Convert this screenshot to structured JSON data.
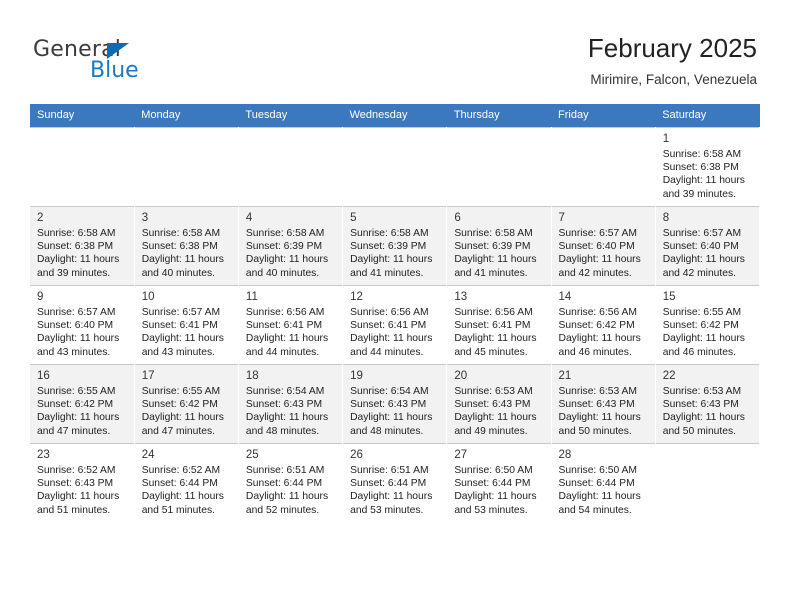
{
  "brand": {
    "name_top": "General",
    "name_bottom": "Blue"
  },
  "header": {
    "title": "February 2025",
    "subtitle": "Mirimire, Falcon, Venezuela"
  },
  "colors": {
    "header_blue": "#3b78bf",
    "brand_blue": "#1a7bc4",
    "row_shade": "#f2f2f2"
  },
  "weekdays": [
    "Sunday",
    "Monday",
    "Tuesday",
    "Wednesday",
    "Thursday",
    "Friday",
    "Saturday"
  ],
  "weeks": [
    [
      {
        "day": ""
      },
      {
        "day": ""
      },
      {
        "day": ""
      },
      {
        "day": ""
      },
      {
        "day": ""
      },
      {
        "day": ""
      },
      {
        "day": "1",
        "sunrise": "Sunrise: 6:58 AM",
        "sunset": "Sunset: 6:38 PM",
        "daylight": "Daylight: 11 hours and 39 minutes."
      }
    ],
    [
      {
        "day": "2",
        "sunrise": "Sunrise: 6:58 AM",
        "sunset": "Sunset: 6:38 PM",
        "daylight": "Daylight: 11 hours and 39 minutes."
      },
      {
        "day": "3",
        "sunrise": "Sunrise: 6:58 AM",
        "sunset": "Sunset: 6:38 PM",
        "daylight": "Daylight: 11 hours and 40 minutes."
      },
      {
        "day": "4",
        "sunrise": "Sunrise: 6:58 AM",
        "sunset": "Sunset: 6:39 PM",
        "daylight": "Daylight: 11 hours and 40 minutes."
      },
      {
        "day": "5",
        "sunrise": "Sunrise: 6:58 AM",
        "sunset": "Sunset: 6:39 PM",
        "daylight": "Daylight: 11 hours and 41 minutes."
      },
      {
        "day": "6",
        "sunrise": "Sunrise: 6:58 AM",
        "sunset": "Sunset: 6:39 PM",
        "daylight": "Daylight: 11 hours and 41 minutes."
      },
      {
        "day": "7",
        "sunrise": "Sunrise: 6:57 AM",
        "sunset": "Sunset: 6:40 PM",
        "daylight": "Daylight: 11 hours and 42 minutes."
      },
      {
        "day": "8",
        "sunrise": "Sunrise: 6:57 AM",
        "sunset": "Sunset: 6:40 PM",
        "daylight": "Daylight: 11 hours and 42 minutes."
      }
    ],
    [
      {
        "day": "9",
        "sunrise": "Sunrise: 6:57 AM",
        "sunset": "Sunset: 6:40 PM",
        "daylight": "Daylight: 11 hours and 43 minutes."
      },
      {
        "day": "10",
        "sunrise": "Sunrise: 6:57 AM",
        "sunset": "Sunset: 6:41 PM",
        "daylight": "Daylight: 11 hours and 43 minutes."
      },
      {
        "day": "11",
        "sunrise": "Sunrise: 6:56 AM",
        "sunset": "Sunset: 6:41 PM",
        "daylight": "Daylight: 11 hours and 44 minutes."
      },
      {
        "day": "12",
        "sunrise": "Sunrise: 6:56 AM",
        "sunset": "Sunset: 6:41 PM",
        "daylight": "Daylight: 11 hours and 44 minutes."
      },
      {
        "day": "13",
        "sunrise": "Sunrise: 6:56 AM",
        "sunset": "Sunset: 6:41 PM",
        "daylight": "Daylight: 11 hours and 45 minutes."
      },
      {
        "day": "14",
        "sunrise": "Sunrise: 6:56 AM",
        "sunset": "Sunset: 6:42 PM",
        "daylight": "Daylight: 11 hours and 46 minutes."
      },
      {
        "day": "15",
        "sunrise": "Sunrise: 6:55 AM",
        "sunset": "Sunset: 6:42 PM",
        "daylight": "Daylight: 11 hours and 46 minutes."
      }
    ],
    [
      {
        "day": "16",
        "sunrise": "Sunrise: 6:55 AM",
        "sunset": "Sunset: 6:42 PM",
        "daylight": "Daylight: 11 hours and 47 minutes."
      },
      {
        "day": "17",
        "sunrise": "Sunrise: 6:55 AM",
        "sunset": "Sunset: 6:42 PM",
        "daylight": "Daylight: 11 hours and 47 minutes."
      },
      {
        "day": "18",
        "sunrise": "Sunrise: 6:54 AM",
        "sunset": "Sunset: 6:43 PM",
        "daylight": "Daylight: 11 hours and 48 minutes."
      },
      {
        "day": "19",
        "sunrise": "Sunrise: 6:54 AM",
        "sunset": "Sunset: 6:43 PM",
        "daylight": "Daylight: 11 hours and 48 minutes."
      },
      {
        "day": "20",
        "sunrise": "Sunrise: 6:53 AM",
        "sunset": "Sunset: 6:43 PM",
        "daylight": "Daylight: 11 hours and 49 minutes."
      },
      {
        "day": "21",
        "sunrise": "Sunrise: 6:53 AM",
        "sunset": "Sunset: 6:43 PM",
        "daylight": "Daylight: 11 hours and 50 minutes."
      },
      {
        "day": "22",
        "sunrise": "Sunrise: 6:53 AM",
        "sunset": "Sunset: 6:43 PM",
        "daylight": "Daylight: 11 hours and 50 minutes."
      }
    ],
    [
      {
        "day": "23",
        "sunrise": "Sunrise: 6:52 AM",
        "sunset": "Sunset: 6:43 PM",
        "daylight": "Daylight: 11 hours and 51 minutes."
      },
      {
        "day": "24",
        "sunrise": "Sunrise: 6:52 AM",
        "sunset": "Sunset: 6:44 PM",
        "daylight": "Daylight: 11 hours and 51 minutes."
      },
      {
        "day": "25",
        "sunrise": "Sunrise: 6:51 AM",
        "sunset": "Sunset: 6:44 PM",
        "daylight": "Daylight: 11 hours and 52 minutes."
      },
      {
        "day": "26",
        "sunrise": "Sunrise: 6:51 AM",
        "sunset": "Sunset: 6:44 PM",
        "daylight": "Daylight: 11 hours and 53 minutes."
      },
      {
        "day": "27",
        "sunrise": "Sunrise: 6:50 AM",
        "sunset": "Sunset: 6:44 PM",
        "daylight": "Daylight: 11 hours and 53 minutes."
      },
      {
        "day": "28",
        "sunrise": "Sunrise: 6:50 AM",
        "sunset": "Sunset: 6:44 PM",
        "daylight": "Daylight: 11 hours and 54 minutes."
      },
      {
        "day": ""
      }
    ]
  ]
}
